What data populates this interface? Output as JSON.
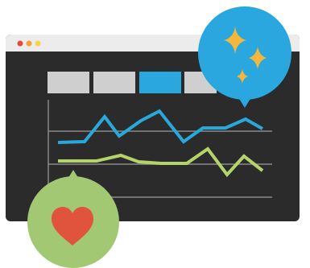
{
  "illustration": {
    "icons": [
      "sparkles-icon",
      "heart-icon"
    ],
    "colors": {
      "window_body": "#2b2b2b",
      "window_titlebar": "#ececec",
      "dot_red": "#e8473a",
      "dot_orange": "#f2a134",
      "dot_yellow": "#f6d34b",
      "tab_gray": "#cfcfcf",
      "tab_active": "#2aa7df",
      "grid_line": "#8a8a8a",
      "line_blue": "#29a8dc",
      "line_green": "#b4d46b",
      "bubble_blue": "#2aa7df",
      "sparkle": "#f4b73c",
      "bubble_green": "#a3c873",
      "heart": "#e0533d"
    },
    "tabs": [
      {
        "active": false
      },
      {
        "active": false
      },
      {
        "active": true
      },
      {
        "active": false
      }
    ],
    "series": [
      {
        "color_key": "line_blue",
        "points": [
          [
            72,
            177
          ],
          [
            105,
            176
          ],
          [
            130,
            145
          ],
          [
            148,
            169
          ],
          [
            175,
            150
          ],
          [
            198,
            138
          ],
          [
            228,
            176
          ],
          [
            252,
            159
          ],
          [
            280,
            159
          ],
          [
            305,
            148
          ],
          [
            326,
            160
          ]
        ]
      },
      {
        "color_key": "line_green",
        "points": [
          [
            72,
            200
          ],
          [
            120,
            200
          ],
          [
            150,
            193
          ],
          [
            172,
            201
          ],
          [
            200,
            203
          ],
          [
            232,
            203
          ],
          [
            258,
            185
          ],
          [
            282,
            217
          ],
          [
            303,
            194
          ],
          [
            326,
            212
          ]
        ]
      }
    ]
  }
}
